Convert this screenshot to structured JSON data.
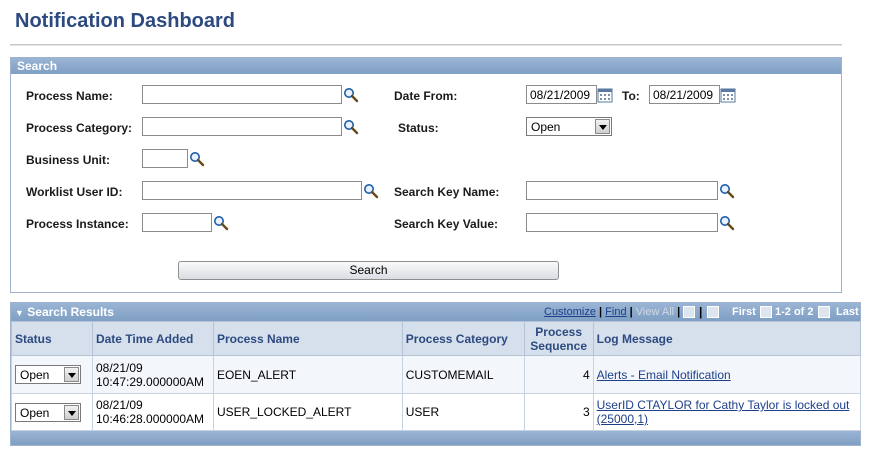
{
  "page": {
    "title": "Notification Dashboard"
  },
  "search": {
    "header": "Search",
    "process_name_label": "Process Name:",
    "process_name_value": "",
    "date_from_label": "Date From:",
    "date_from_value": "08/21/2009",
    "to_label": "To:",
    "to_value": "08/21/2009",
    "process_category_label": "Process Category:",
    "process_category_value": "",
    "status_label": "Status:",
    "status_value": "Open",
    "business_unit_label": "Business Unit:",
    "business_unit_value": "",
    "worklist_user_label": "Worklist User ID:",
    "worklist_user_value": "",
    "search_key_name_label": "Search Key Name:",
    "search_key_name_value": "",
    "process_instance_label": "Process Instance:",
    "process_instance_value": "",
    "search_key_value_label": "Search Key Value:",
    "search_key_value_value": "",
    "search_button": "Search"
  },
  "results": {
    "header": "Search Results",
    "customize": "Customize",
    "find": "Find",
    "view_all": "View All",
    "first": "First",
    "count": "1-2 of 2",
    "last": "Last",
    "columns": {
      "status": "Status",
      "date_time": "Date Time Added",
      "process_name": "Process Name",
      "process_category": "Process Category",
      "process_sequence": "Process Sequence",
      "log_message": "Log Message"
    },
    "rows": [
      {
        "status": "Open",
        "date": "08/21/09",
        "time": "10:47:29.000000AM",
        "process_name": "EOEN_ALERT",
        "process_category": "CUSTOMEMAIL",
        "process_sequence": "4",
        "log_message": "Alerts - Email Notification"
      },
      {
        "status": "Open",
        "date": "08/21/09",
        "time": "10:46:28.000000AM",
        "process_name": "USER_LOCKED_ALERT",
        "process_category": "USER",
        "process_sequence": "3",
        "log_message": "UserID CTAYLOR for Cathy Taylor is locked out (25000,1)"
      }
    ]
  },
  "icons": {
    "lookup": "magnifier-lookup-icon",
    "calendar": "calendar-icon",
    "dropdown": "chevron-down-icon",
    "download": "download-icon",
    "zoom": "grid-zoom-icon",
    "first": "arrow-left-icon",
    "last": "arrow-right-icon"
  },
  "colors": {
    "title": "#2d4a80",
    "header_bar": "#8aa8cc",
    "link": "#1e3f8a",
    "column_header_bg": "#d6e0ec"
  }
}
